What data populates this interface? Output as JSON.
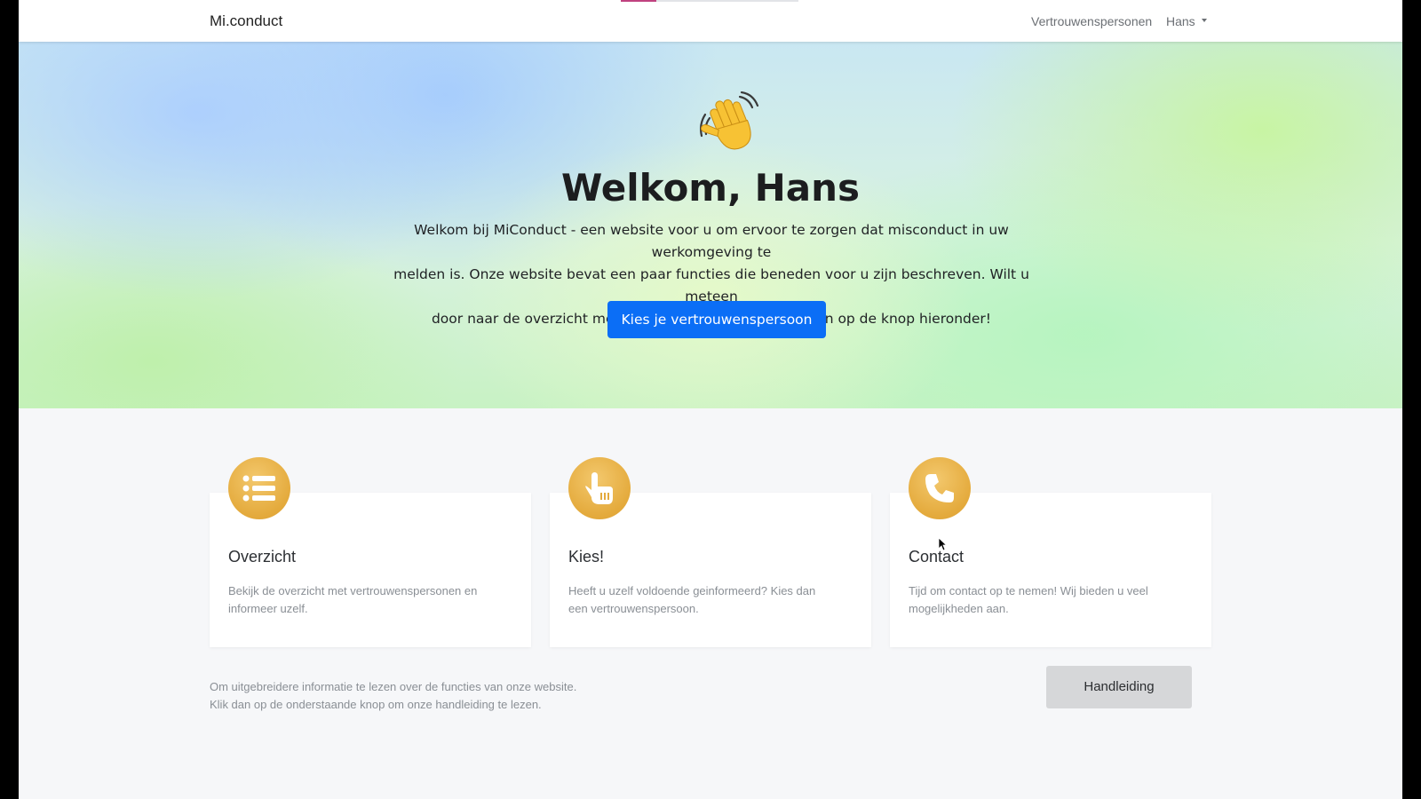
{
  "navbar": {
    "brand": "Mi.conduct",
    "links": {
      "vertrouwenspersonen": "Vertrouwenspersonen",
      "user": "Hans"
    },
    "loading_progress": 0.2
  },
  "hero": {
    "emoji": "👋",
    "title": "Welkom, Hans",
    "text_lines": [
      "Welkom bij MiConduct - een website voor u om ervoor te zorgen dat misconduct in uw werkomgeving te",
      "melden is. Onze website bevat een paar functies die beneden voor u zijn beschreven. Wilt u meteen",
      "door naar de overzicht met vertrouwenpersonen? Klik dan op de knop hieronder!"
    ],
    "button_label": "Kies je vertrouwenspersoon"
  },
  "cards": [
    {
      "icon": "list-icon",
      "title": "Overzicht",
      "desc_lines": [
        "Bekijk de overzicht met vertrouwenspersonen en",
        "informeer uzelf."
      ]
    },
    {
      "icon": "pointing-hand-icon",
      "title": "Kies!",
      "desc_lines": [
        "Heeft u uzelf voldoende geinformeerd? Kies dan",
        "een vertrouwenspersoon."
      ]
    },
    {
      "icon": "phone-icon",
      "title": "Contact",
      "desc_lines": [
        "Tijd om contact op te nemen! Wij bieden u veel",
        "mogelijkheden aan."
      ]
    }
  ],
  "footer": {
    "info_lines": [
      "Om uitgebreidere informatie te lezen over de functies van onze website.",
      "Klik dan op de onderstaande knop om onze handleiding te lezen."
    ],
    "manual_button": "Handleiding"
  },
  "colors": {
    "primary_button": "#0b6ef6",
    "icon_gold": "#e4aa3c",
    "loadbar_accent": "#c0427f"
  }
}
